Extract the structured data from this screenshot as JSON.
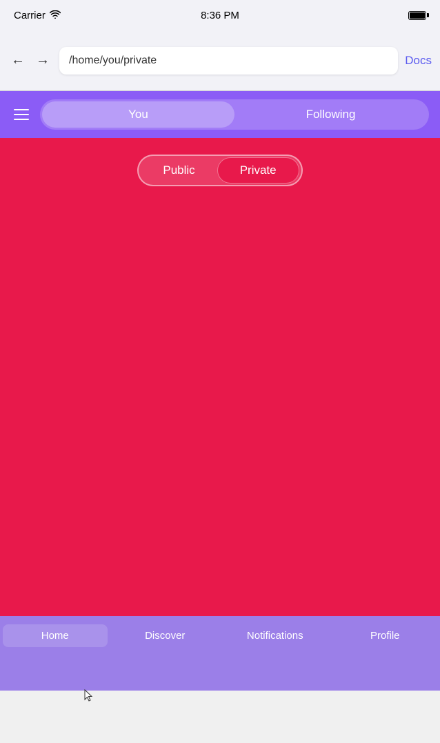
{
  "status_bar": {
    "carrier": "Carrier",
    "wifi": "📶",
    "time": "8:36 PM"
  },
  "browser": {
    "url": "/home/you/private",
    "docs_label": "Docs",
    "back_label": "←",
    "forward_label": "→"
  },
  "nav_bar": {
    "tab_you_label": "You",
    "tab_following_label": "Following"
  },
  "content": {
    "tab_public_label": "Public",
    "tab_private_label": "Private"
  },
  "bottom_tabs": {
    "home_label": "Home",
    "discover_label": "Discover",
    "notifications_label": "Notifications",
    "profile_label": "Profile"
  },
  "colors": {
    "purple_nav": "#8b5cf6",
    "purple_bottom": "#9b7fe8",
    "red_main": "#e8194b",
    "tab_active_bg": "#b89df8"
  }
}
